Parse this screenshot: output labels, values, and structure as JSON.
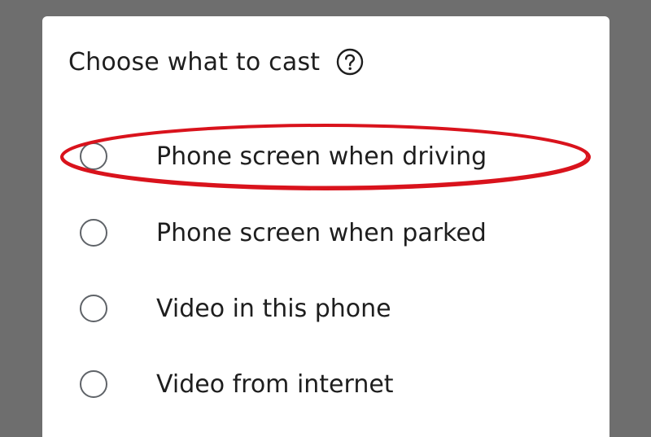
{
  "dialog": {
    "title": "Choose what to cast",
    "help_icon": "help-circle-icon",
    "options": [
      {
        "label": "Phone screen when driving",
        "selected": false,
        "highlighted": true
      },
      {
        "label": "Phone screen when parked",
        "selected": false,
        "highlighted": false
      },
      {
        "label": "Video in this phone",
        "selected": false,
        "highlighted": false
      },
      {
        "label": "Video from internet",
        "selected": false,
        "highlighted": false
      }
    ]
  },
  "colors": {
    "backdrop": "#6e6e6e",
    "dialog_background": "#ffffff",
    "text": "#1e1e1e",
    "radio_border": "#5f6368",
    "highlight_annotation": "#d9131c"
  }
}
